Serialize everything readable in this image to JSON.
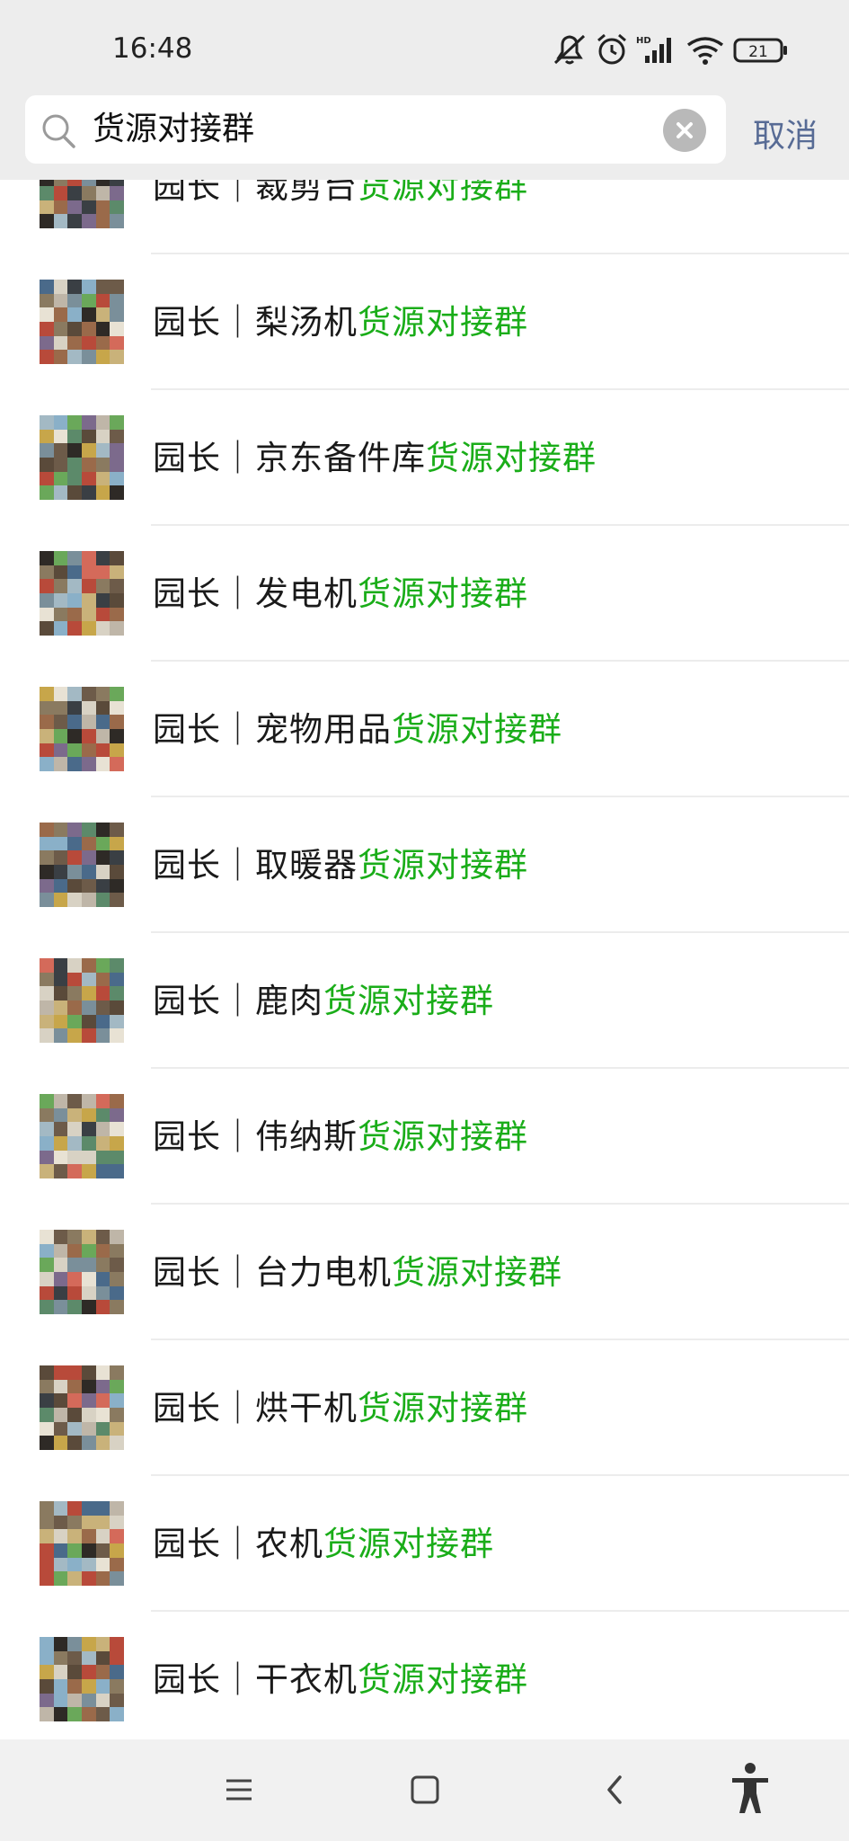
{
  "status": {
    "time": "16:48",
    "battery": "21",
    "network": "HD"
  },
  "search": {
    "query": "货源对接群",
    "cancel_label": "取消"
  },
  "results": [
    {
      "prefix": "园长｜裁剪台",
      "highlight": "货源对接群"
    },
    {
      "prefix": "园长｜梨汤机",
      "highlight": "货源对接群"
    },
    {
      "prefix": "园长｜京东备件库",
      "highlight": "货源对接群"
    },
    {
      "prefix": "园长｜发电机",
      "highlight": "货源对接群"
    },
    {
      "prefix": "园长｜宠物用品",
      "highlight": "货源对接群"
    },
    {
      "prefix": "园长｜取暖器",
      "highlight": "货源对接群"
    },
    {
      "prefix": "园长｜鹿肉",
      "highlight": "货源对接群"
    },
    {
      "prefix": "园长｜伟纳斯",
      "highlight": "货源对接群"
    },
    {
      "prefix": "园长｜台力电机",
      "highlight": "货源对接群"
    },
    {
      "prefix": "园长｜烘干机",
      "highlight": "货源对接群"
    },
    {
      "prefix": "园长｜农机",
      "highlight": "货源对接群"
    },
    {
      "prefix": "园长｜干衣机",
      "highlight": "货源对接群"
    }
  ],
  "colors": {
    "highlight": "#1aad19",
    "cancel": "#576b95",
    "header_bg": "#ededed"
  },
  "icons": [
    "mute-icon",
    "alarm-icon",
    "signal-icon",
    "wifi-icon",
    "battery-icon",
    "search-icon",
    "clear-icon",
    "menu-icon",
    "home-icon",
    "back-icon",
    "accessibility-icon"
  ]
}
